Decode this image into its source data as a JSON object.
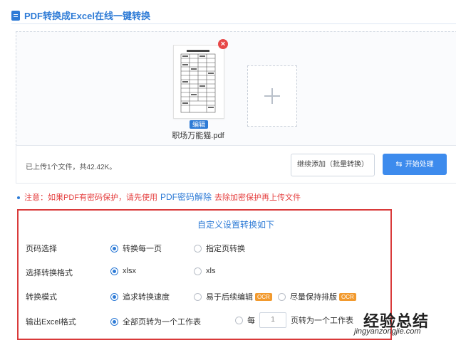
{
  "header": {
    "title": "PDF转换成Excel在线一键转换"
  },
  "upload": {
    "file_name": "职场万能猫.pdf",
    "edit_badge": "编辑",
    "remove_symbol": "×",
    "status": "已上传1个文件，共42.42K。",
    "batch_add_label": "继续添加（批量转换）",
    "start_label": "开始处理"
  },
  "notice": {
    "prefix": "注意：如果PDF有密码保护，请先使用",
    "link": "PDF密码解除",
    "suffix": "去除加密保护再上传文件"
  },
  "settings": {
    "title": "自定义设置转换如下",
    "rows": [
      {
        "label": "页码选择",
        "options": [
          "转换每一页",
          "指定页转换"
        ],
        "selected": 0
      },
      {
        "label": "选择转换格式",
        "options": [
          "xlsx",
          "xls"
        ],
        "selected": 0
      },
      {
        "label": "转换模式",
        "options": [
          "追求转换速度",
          "易于后续编辑",
          "尽量保持排版"
        ],
        "selected": 0,
        "badge": "OCR"
      },
      {
        "label": "输出Excel格式",
        "options": [
          "全部页转为一个工作表",
          "每",
          "页转为一个工作表"
        ],
        "selected": 0,
        "page_value": "1"
      }
    ]
  },
  "watermark": {
    "main": "经验总结",
    "sub": "jingyanzongjie.com"
  },
  "colors": {
    "accent": "#2e7bd6",
    "warning": "#e54040",
    "highlight_border": "#d93a3a",
    "ocr_badge": "#f29a2e"
  }
}
